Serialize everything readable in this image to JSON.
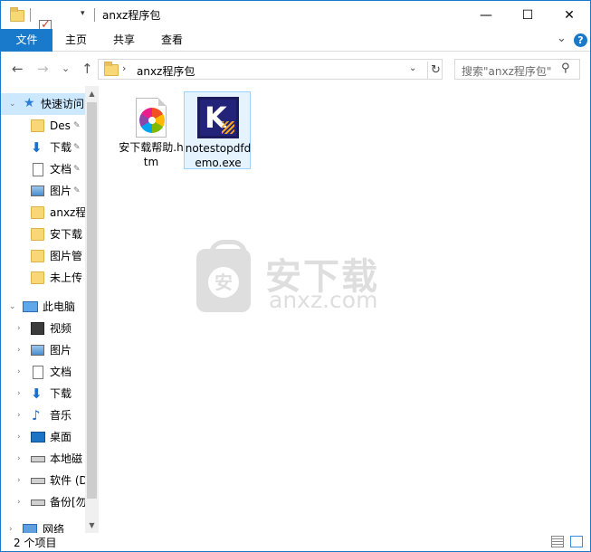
{
  "window": {
    "title": "anxz程序包",
    "qat_dropdown": "▾",
    "minimize": "—",
    "maximize": "☐",
    "close": "✕"
  },
  "ribbon": {
    "tabs": [
      {
        "label": "文件"
      },
      {
        "label": "主页"
      },
      {
        "label": "共享"
      },
      {
        "label": "查看"
      }
    ],
    "expand_glyph": "⌄",
    "help_glyph": "?"
  },
  "address": {
    "back": "←",
    "forward": "→",
    "recent": "⌄",
    "up": "↑",
    "separator": "›",
    "path": "anxz程序包",
    "dropdown": "⌄",
    "refresh": "↻"
  },
  "search": {
    "placeholder": "搜索\"anxz程序包\"",
    "icon_glyph": "⚲"
  },
  "nav": {
    "quick_access": {
      "label": "快速访问",
      "chevron": "⌄"
    },
    "quick_items": [
      {
        "label": "Des",
        "pinned": true
      },
      {
        "label": "下载",
        "pinned": true
      },
      {
        "label": "文档",
        "pinned": true
      },
      {
        "label": "图片",
        "pinned": true
      },
      {
        "label": "anxz程",
        "pinned": false
      },
      {
        "label": "安下载",
        "pinned": false
      },
      {
        "label": "图片管",
        "pinned": false
      },
      {
        "label": "未上传",
        "pinned": false
      }
    ],
    "pin_glyph": "📌",
    "this_pc": {
      "label": "此电脑",
      "chevron": "⌄"
    },
    "pc_items": [
      {
        "label": "视频"
      },
      {
        "label": "图片"
      },
      {
        "label": "文档"
      },
      {
        "label": "下载"
      },
      {
        "label": "音乐"
      },
      {
        "label": "桌面"
      },
      {
        "label": "本地磁"
      },
      {
        "label": "软件 (D"
      },
      {
        "label": "备份[勿"
      },
      {
        "label": "网络"
      }
    ],
    "child_chevron": "›",
    "scroll_up": "▲",
    "scroll_down": "▼"
  },
  "files": [
    {
      "name": "安下载帮助.htm",
      "type": "htm",
      "selected": false
    },
    {
      "name": "notestopdfdemo.exe",
      "type": "exe",
      "selected": true,
      "icon_letter": "K"
    }
  ],
  "watermark": {
    "bag_char": "安",
    "cn": "安下载",
    "en": "anxz.com"
  },
  "status": {
    "item_count": "2 个项目"
  }
}
